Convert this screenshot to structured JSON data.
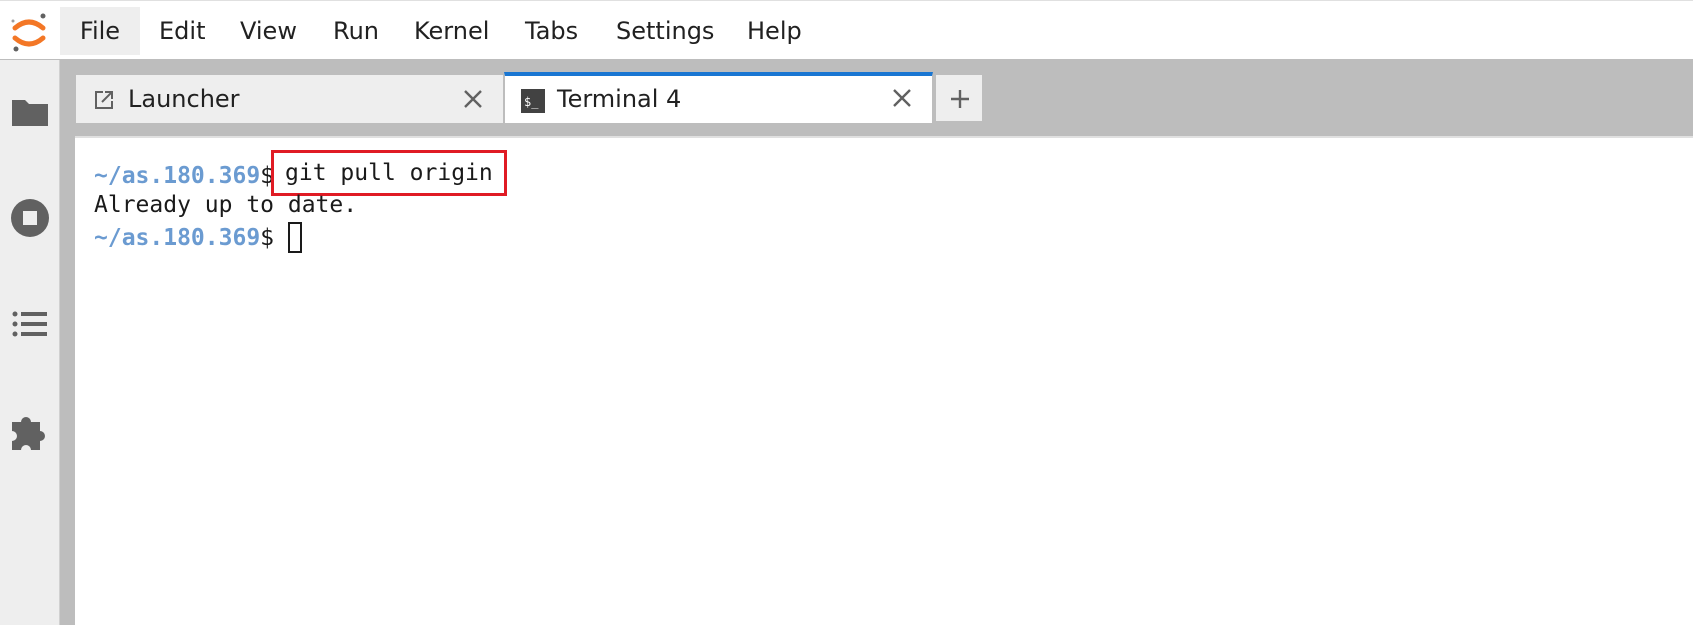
{
  "menubar": {
    "items": [
      {
        "label": "File",
        "active": true
      },
      {
        "label": "Edit"
      },
      {
        "label": "View"
      },
      {
        "label": "Run"
      },
      {
        "label": "Kernel"
      },
      {
        "label": "Tabs"
      },
      {
        "label": "Settings"
      },
      {
        "label": "Help"
      }
    ]
  },
  "sidebar": {
    "items": [
      {
        "icon": "folder-icon"
      },
      {
        "icon": "stop-circle-icon"
      },
      {
        "icon": "list-icon"
      },
      {
        "icon": "puzzle-icon"
      }
    ]
  },
  "tabs": [
    {
      "label": "Launcher",
      "icon": "launch-icon",
      "active": false
    },
    {
      "label": "Terminal 4",
      "icon": "terminal-icon",
      "active": true
    }
  ],
  "terminal": {
    "prompt": "~/as.180.369",
    "prompt_symbol": "$",
    "command": "git pull origin",
    "output": "Already up to date."
  },
  "colors": {
    "accent": "#1976d2",
    "prompt": "#6b9bd1",
    "highlight": "#e01b24",
    "logo": "#f37726"
  }
}
